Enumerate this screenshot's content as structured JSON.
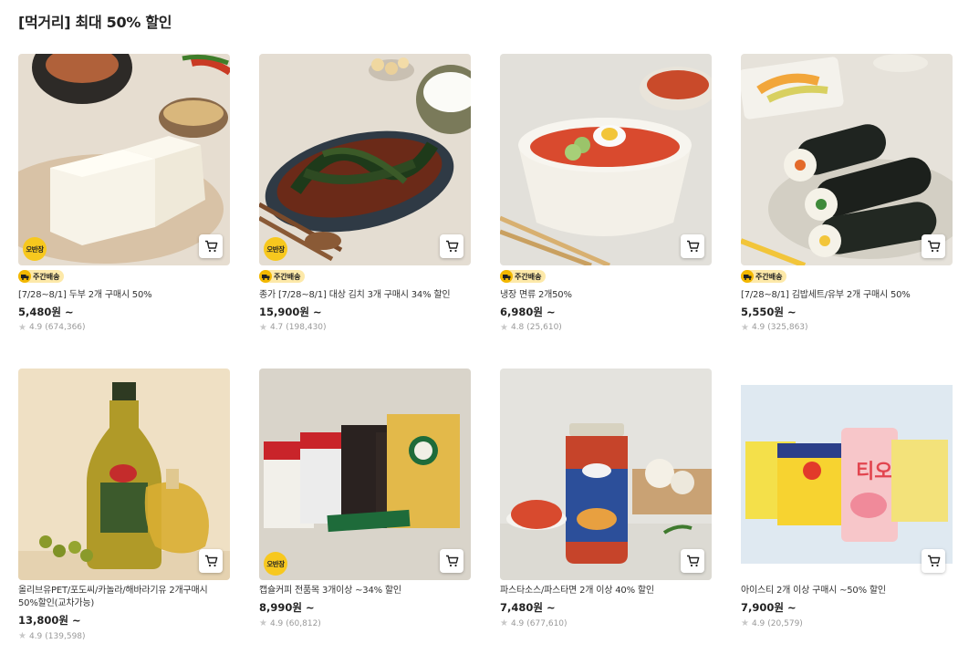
{
  "section": {
    "title": "[먹거리] 최대 50% 할인"
  },
  "badges": {
    "obanjang": "오반장",
    "weekly_delivery": "주간배송"
  },
  "products": [
    {
      "name": "[7/28~8/1] 두부 2개 구매시 50%",
      "price": "5,480원 ~",
      "rating": "4.9",
      "reviews": "(674,366)",
      "obanjang": true,
      "weekly": true
    },
    {
      "name": "종가 [7/28~8/1] 대상 김치 3개 구매시 34% 할인",
      "price": "15,900원 ~",
      "rating": "4.7",
      "reviews": "(198,430)",
      "obanjang": true,
      "weekly": true
    },
    {
      "name": "냉장 면류 2개50%",
      "price": "6,980원 ~",
      "rating": "4.8",
      "reviews": "(25,610)",
      "obanjang": false,
      "weekly": true
    },
    {
      "name": "[7/28~8/1] 김밥세트/유부 2개 구매시 50%",
      "price": "5,550원 ~",
      "rating": "4.9",
      "reviews": "(325,863)",
      "obanjang": false,
      "weekly": true
    },
    {
      "name": "올리브유PET/포도씨/카놀라/해바라기유 2개구매시 50%할인(교차가능)",
      "price": "13,800원 ~",
      "rating": "4.9",
      "reviews": "(139,598)",
      "obanjang": false,
      "weekly": false
    },
    {
      "name": "캡슐커피 전품목 3개이상 ~34% 할인",
      "price": "8,990원 ~",
      "rating": "4.9",
      "reviews": "(60,812)",
      "obanjang": true,
      "weekly": false
    },
    {
      "name": "파스타소스/파스타면 2개 이상 40% 할인",
      "price": "7,480원 ~",
      "rating": "4.9",
      "reviews": "(677,610)",
      "obanjang": false,
      "weekly": false
    },
    {
      "name": "아이스티 2개 이상 구매시 ~50% 할인",
      "price": "7,900원 ~",
      "rating": "4.9",
      "reviews": "(20,579)",
      "obanjang": false,
      "weekly": false
    }
  ],
  "icons": {
    "cart": "cart-icon",
    "star": "star-icon",
    "truck": "truck-icon"
  },
  "colors": {
    "badge_yellow": "#f7c81e",
    "delivery_bg": "#fde9a9",
    "star": "#c8c8c8"
  }
}
